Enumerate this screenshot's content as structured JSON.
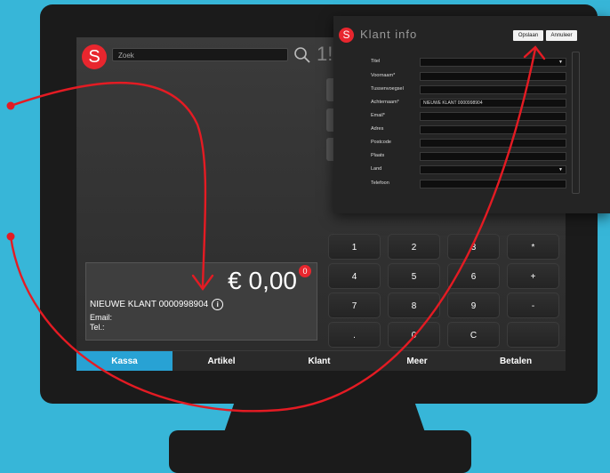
{
  "header": {
    "logo_letter": "S",
    "search_placeholder": "Zoek",
    "fragment": "1!"
  },
  "total": {
    "amount": "€ 0,00",
    "badge": "0",
    "customer_name": "NIEUWE KLANT 0000998904",
    "email_label": "Email:",
    "tel_label": "Tel.:"
  },
  "keypad": [
    "1",
    "2",
    "3",
    "*",
    "4",
    "5",
    "6",
    "+",
    "7",
    "8",
    "9",
    "-",
    ".",
    "0",
    "C",
    ""
  ],
  "tabs": [
    "Kassa",
    "Artikel",
    "Klant",
    "Meer",
    "Betalen"
  ],
  "active_tab": "Kassa",
  "dialog": {
    "logo_letter": "S",
    "title": "Klant info",
    "save_label": "Opslaan",
    "cancel_label": "Annuleer",
    "fields": [
      {
        "label": "Titel",
        "value": "",
        "type": "select"
      },
      {
        "label": "Voornaam*",
        "value": "",
        "type": "text"
      },
      {
        "label": "Tussenvoegsel",
        "value": "",
        "type": "text"
      },
      {
        "label": "Achternaam*",
        "value": "NIEUWE KLANT 0000998904",
        "type": "text"
      },
      {
        "label": "Email*",
        "value": "",
        "type": "text"
      },
      {
        "label": "Adres",
        "value": "",
        "type": "text"
      },
      {
        "label": "Postcode",
        "value": "",
        "type": "text"
      },
      {
        "label": "Plaats",
        "value": "",
        "type": "text"
      },
      {
        "label": "Land",
        "value": "",
        "type": "select"
      },
      {
        "label": "Telefoon",
        "value": "",
        "type": "text"
      }
    ]
  },
  "colors": {
    "background": "#37b6d8",
    "accent": "#28a2d4",
    "brand_red": "#e8262e",
    "arrow": "#e41b23"
  }
}
